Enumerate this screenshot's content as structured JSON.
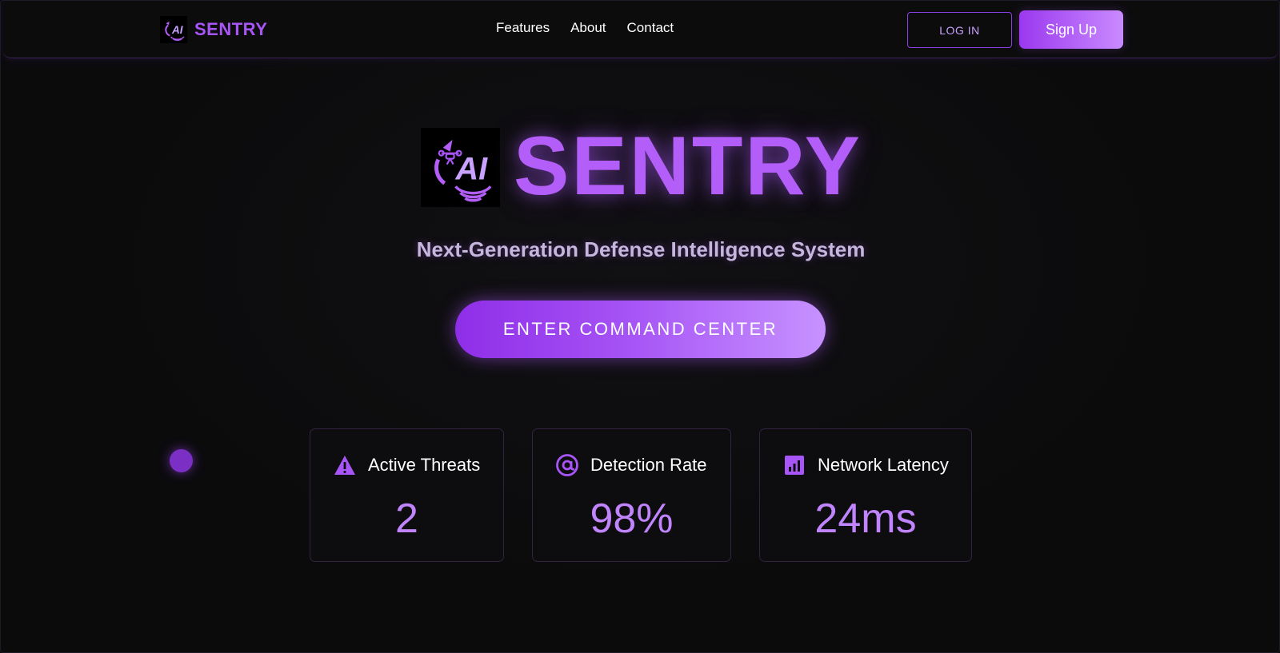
{
  "brand": {
    "name": "SENTRY",
    "logo_text": "AI"
  },
  "nav": {
    "links": [
      "Features",
      "About",
      "Contact"
    ],
    "login_label": "LOG IN",
    "signup_label": "Sign Up"
  },
  "hero": {
    "title": "SENTRY",
    "logo_text": "AI",
    "subtitle": "Next-Generation Defense Intelligence System",
    "cta_label": "ENTER COMMAND CENTER"
  },
  "stats": [
    {
      "label": "Active Threats",
      "value": "2",
      "icon": "warning-triangle-icon"
    },
    {
      "label": "Detection Rate",
      "value": "98%",
      "icon": "at-target-icon"
    },
    {
      "label": "Network Latency",
      "value": "24ms",
      "icon": "bar-chart-icon"
    }
  ],
  "colors": {
    "accent": "#a855f7",
    "accent_light": "#c084fc",
    "background": "#0b0b0c",
    "subtitle": "#c6b6dd",
    "card_border": "#322342"
  }
}
